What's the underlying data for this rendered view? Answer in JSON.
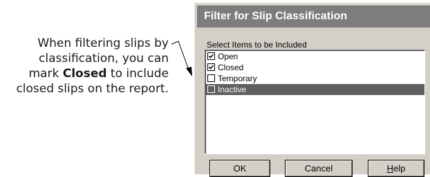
{
  "callout": {
    "line1": "When filtering slips by",
    "line2": "classification, you can",
    "line3_prefix": "mark ",
    "line3_bold": "Closed",
    "line3_suffix": " to include",
    "line4": "closed slips on the report."
  },
  "dialog": {
    "title": "Filter for Slip Classification",
    "group_label": "Select Items to be Included",
    "items": [
      {
        "label": "Open",
        "checked": true,
        "selected": false
      },
      {
        "label": "Closed",
        "checked": true,
        "selected": false
      },
      {
        "label": "Temporary",
        "checked": false,
        "selected": false
      },
      {
        "label": "Inactive",
        "checked": false,
        "selected": true
      }
    ],
    "buttons": {
      "ok": "OK",
      "cancel": "Cancel",
      "help_mnemonic": "H",
      "help_rest": "elp"
    }
  },
  "colors": {
    "titlebar": "#7d7d7d",
    "dialog_face": "#d4d0c8",
    "selection": "#5f5f5f"
  }
}
